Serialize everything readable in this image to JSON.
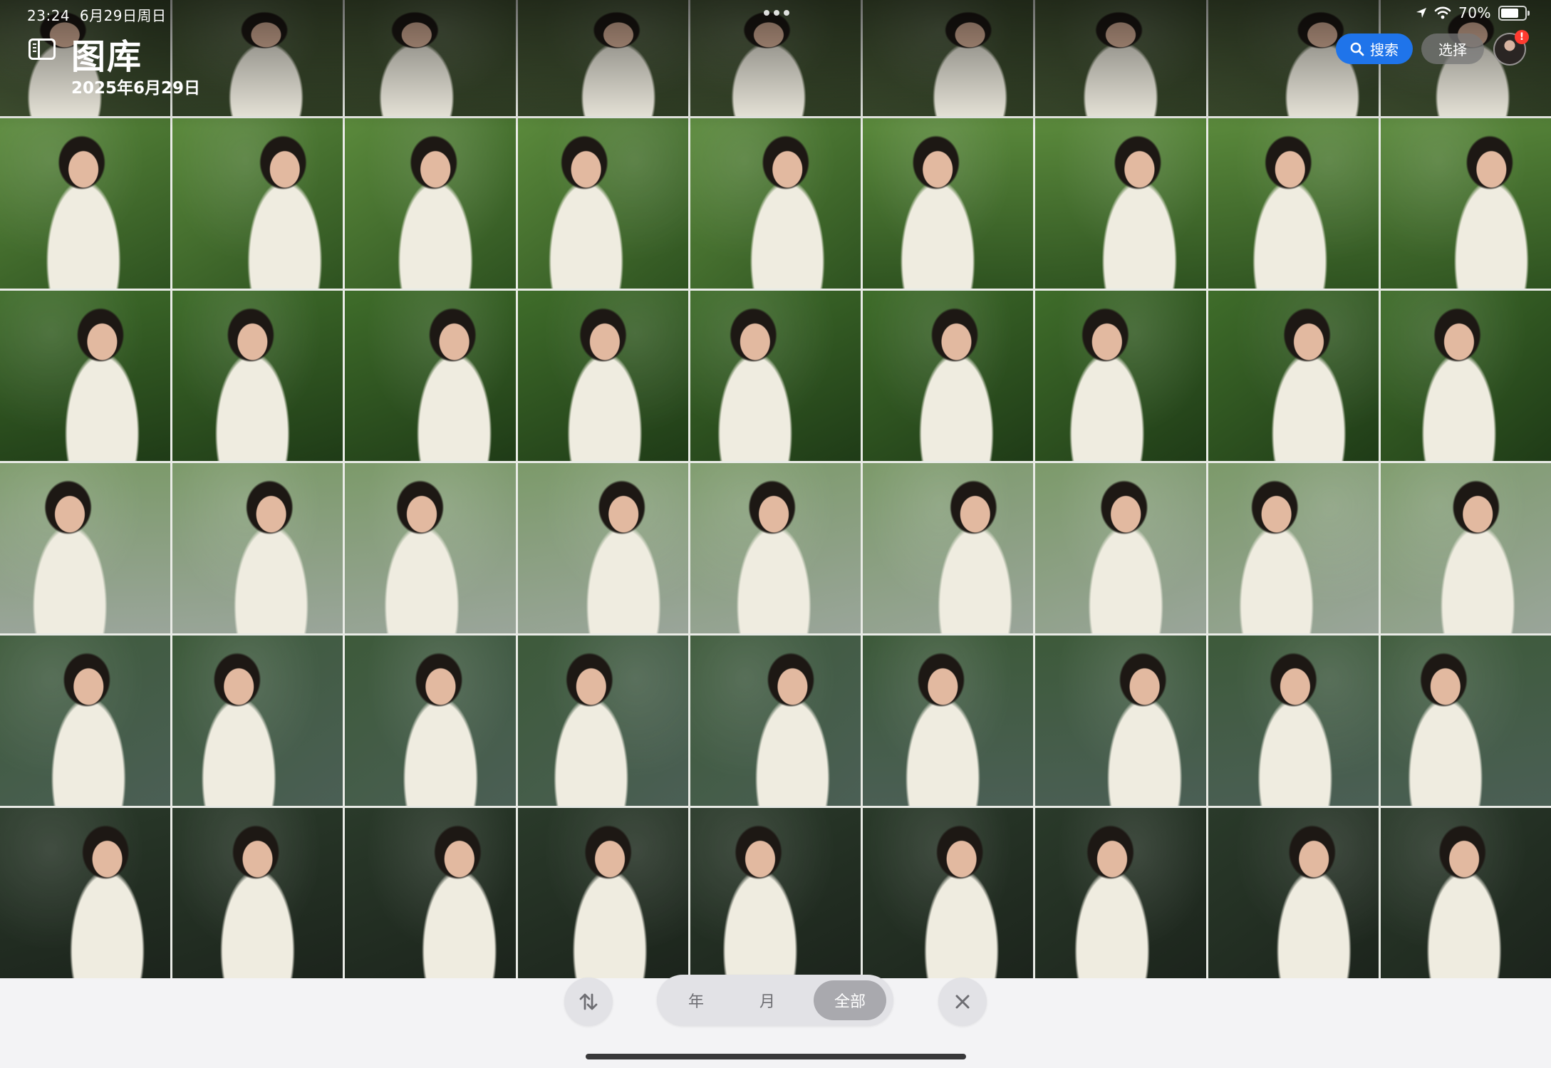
{
  "status_bar": {
    "time": "23:24",
    "date": "6月29日周日",
    "battery": "70%"
  },
  "header": {
    "title": "图库",
    "date": "2025年6月29日"
  },
  "toolbar": {
    "search_label": "搜索",
    "select_label": "选择",
    "alert": "!"
  },
  "scope": {
    "year": "年",
    "month": "月",
    "all": "全部",
    "selected": "all"
  },
  "icons": {
    "sidebar": "sidebar-icon",
    "search": "search-icon",
    "sort": "sort-arrows-icon",
    "close": "close-icon",
    "location": "location-arrow-icon",
    "wifi": "wifi-icon",
    "battery": "battery-icon"
  },
  "colors": {
    "accent": "#1f74ea",
    "badge": "#ff3b30"
  },
  "grid": {
    "columns": 9,
    "rows": 6
  }
}
